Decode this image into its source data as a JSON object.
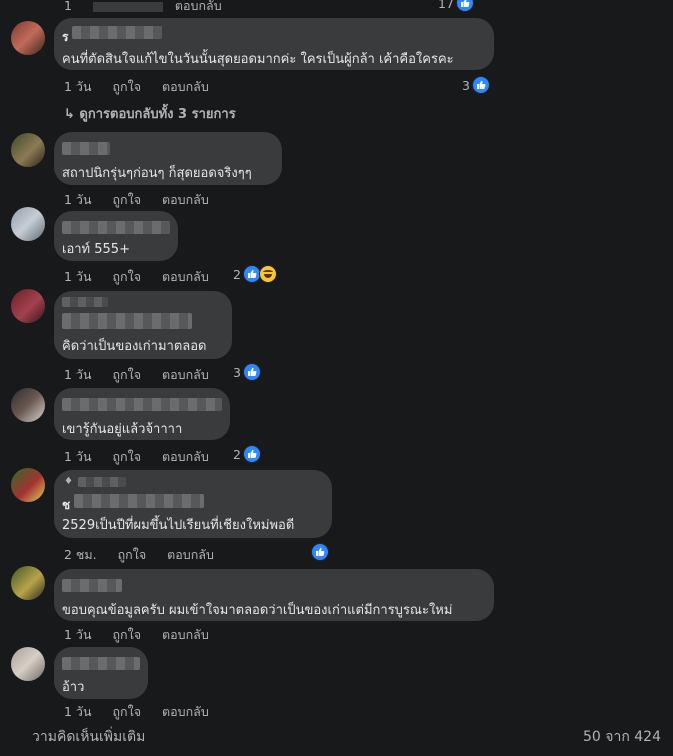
{
  "colors": {
    "background": "#18191a",
    "bubble": "#3a3b3c",
    "like": "#2d88ff",
    "text": "#e4e6eb",
    "muted": "#b0b3b8"
  },
  "top_partial": {
    "actions": [
      "1",
      "ตอบกลับ"
    ],
    "reaction_count": "17"
  },
  "comments": [
    {
      "prefix": "ร",
      "text": "คนที่ตัดสินใจแก้ไขในวันนั้นสุดยอดมากค่ะ ใครเป็นผู้กล้า เค้าคือใครคะ",
      "time": "1 วัน",
      "like": "ถูกใจ",
      "reply": "ตอบกลับ",
      "reaction_count": "3",
      "reactions": [
        "like-icon"
      ]
    },
    {
      "prefix": "",
      "text": "สถาปนิกรุ่นๆก่อนๆ ก็สุดยอดจริงๆๆ",
      "time": "1 วัน",
      "like": "ถูกใจ",
      "reply": "ตอบกลับ",
      "reaction_count": "",
      "reactions": []
    },
    {
      "prefix": "",
      "text": "เอาท์ 555+",
      "time": "1 วัน",
      "like": "ถูกใจ",
      "reply": "ตอบกลับ",
      "reaction_count": "2",
      "reactions": [
        "like-icon",
        "haha-icon"
      ]
    },
    {
      "prefix": "",
      "text": "คิดว่าเป็นของเก่ามาตลอด",
      "time": "1 วัน",
      "like": "ถูกใจ",
      "reply": "ตอบกลับ",
      "reaction_count": "3",
      "reactions": [
        "like-icon"
      ]
    },
    {
      "prefix": "",
      "text": "เขารู้กันอยู่แล้วจ้าาาา",
      "time": "1 วัน",
      "like": "ถูกใจ",
      "reply": "ตอบกลับ",
      "reaction_count": "2",
      "reactions": [
        "like-icon"
      ]
    },
    {
      "prefix": "ช",
      "text": "2529เป็นปีที่ผมขึ้นไปเรียนที่เชียงใหม่พอดี",
      "time": "2 ชม.",
      "like": "ถูกใจ",
      "reply": "ตอบกลับ",
      "reaction_count": "",
      "reactions": [
        "like-icon"
      ]
    },
    {
      "prefix": "",
      "text": "ขอบคุณข้อมูลครับ ผมเข้าใจมาตลอดว่าเป็นของเก่าแต่มีการบูรณะใหม่",
      "time": "1 วัน",
      "like": "ถูกใจ",
      "reply": "ตอบกลับ",
      "reaction_count": "",
      "reactions": []
    },
    {
      "prefix": "",
      "text": "อ้าว",
      "time": "1 วัน",
      "like": "ถูกใจ",
      "reply": "ตอบกลับ",
      "reaction_count": "",
      "reactions": []
    }
  ],
  "view_replies": "ดูการตอบกลับทั้ง 3 รายการ",
  "more_comments": "วามคิดเห็นเพิ่มเติม",
  "pagination": "50 จาก 424"
}
